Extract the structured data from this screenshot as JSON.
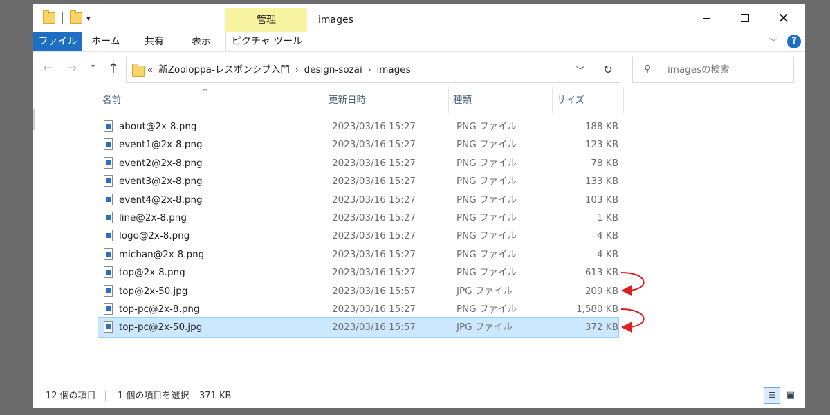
{
  "title_bar": {
    "manage_tab": "管理",
    "window_title": "images"
  },
  "ribbon": {
    "tabs": [
      "ファイル",
      "ホーム",
      "共有",
      "表示",
      "ピクチャ ツール"
    ]
  },
  "address": {
    "overflow": "«",
    "crumbs": [
      "新Zooloppa-レスポンシブ入門",
      "design-sozai",
      "images"
    ],
    "search_placeholder": "imagesの検索"
  },
  "columns": {
    "name": "名前",
    "date": "更新日時",
    "type": "種類",
    "size": "サイズ"
  },
  "files": [
    {
      "name": "about@2x-8.png",
      "date": "2023/03/16 15:27",
      "type": "PNG ファイル",
      "size": "188 KB"
    },
    {
      "name": "event1@2x-8.png",
      "date": "2023/03/16 15:27",
      "type": "PNG ファイル",
      "size": "123 KB"
    },
    {
      "name": "event2@2x-8.png",
      "date": "2023/03/16 15:27",
      "type": "PNG ファイル",
      "size": "78 KB"
    },
    {
      "name": "event3@2x-8.png",
      "date": "2023/03/16 15:27",
      "type": "PNG ファイル",
      "size": "133 KB"
    },
    {
      "name": "event4@2x-8.png",
      "date": "2023/03/16 15:27",
      "type": "PNG ファイル",
      "size": "103 KB"
    },
    {
      "name": "line@2x-8.png",
      "date": "2023/03/16 15:27",
      "type": "PNG ファイル",
      "size": "1 KB"
    },
    {
      "name": "logo@2x-8.png",
      "date": "2023/03/16 15:27",
      "type": "PNG ファイル",
      "size": "4 KB"
    },
    {
      "name": "michan@2x-8.png",
      "date": "2023/03/16 15:27",
      "type": "PNG ファイル",
      "size": "4 KB"
    },
    {
      "name": "top@2x-8.png",
      "date": "2023/03/16 15:27",
      "type": "PNG ファイル",
      "size": "613 KB"
    },
    {
      "name": "top@2x-50.jpg",
      "date": "2023/03/16 15:57",
      "type": "JPG ファイル",
      "size": "209 KB"
    },
    {
      "name": "top-pc@2x-8.png",
      "date": "2023/03/16 15:27",
      "type": "PNG ファイル",
      "size": "1,580 KB"
    },
    {
      "name": "top-pc@2x-50.jpg",
      "date": "2023/03/16 15:57",
      "type": "JPG ファイル",
      "size": "372 KB"
    }
  ],
  "selected_index": 11,
  "status": {
    "item_count": "12 個の項目",
    "selected": "1 個の項目を選択",
    "selected_size": "371 KB"
  },
  "colors": {
    "file_tab": "#1e6fc4",
    "manage_tab": "#f7f3a1",
    "selection": "#cce8ff",
    "annotation_arrow": "#e02020"
  }
}
